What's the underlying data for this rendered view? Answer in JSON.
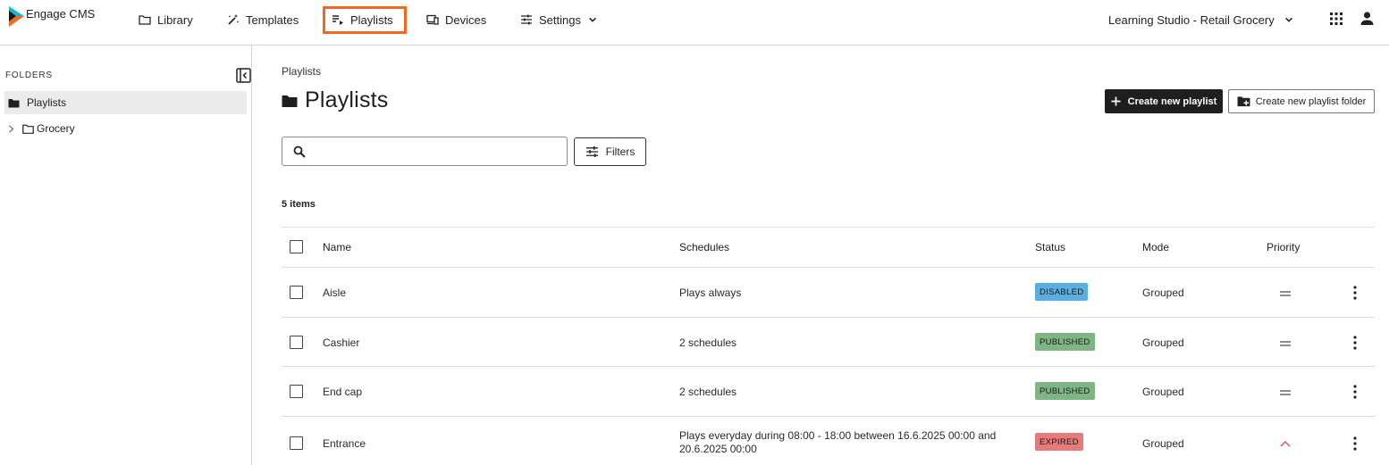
{
  "app": {
    "name": "Engage CMS"
  },
  "nav": {
    "library": "Library",
    "templates": "Templates",
    "playlists": "Playlists",
    "devices": "Devices",
    "settings": "Settings"
  },
  "org": {
    "name": "Learning Studio - Retail Grocery"
  },
  "sidebar": {
    "title": "FOLDERS",
    "folders": [
      {
        "label": "Playlists"
      },
      {
        "label": "Grocery"
      }
    ]
  },
  "main": {
    "breadcrumb": "Playlists",
    "title": "Playlists",
    "create_playlist": "Create new playlist",
    "create_folder": "Create new playlist folder",
    "search_placeholder": "",
    "filters": "Filters",
    "item_count": "5 items"
  },
  "table": {
    "headers": {
      "name": "Name",
      "schedules": "Schedules",
      "status": "Status",
      "mode": "Mode",
      "priority": "Priority"
    },
    "rows": [
      {
        "name": "Aisle",
        "schedules": "Plays always",
        "status": "DISABLED",
        "mode": "Grouped",
        "priority": "normal"
      },
      {
        "name": "Cashier",
        "schedules": "2 schedules",
        "status": "PUBLISHED",
        "mode": "Grouped",
        "priority": "normal"
      },
      {
        "name": "End cap",
        "schedules": "2 schedules",
        "status": "PUBLISHED",
        "mode": "Grouped",
        "priority": "normal"
      },
      {
        "name": "Entrance",
        "schedules": "Plays everyday during 08:00 - 18:00 between 16.6.2025 00:00 and 20.6.2025 00:00",
        "status": "EXPIRED",
        "mode": "Grouped",
        "priority": "high"
      }
    ]
  },
  "colors": {
    "accent_highlight": "#f06a1d",
    "status_disabled": "#5aaee0",
    "status_published": "#7fb584",
    "status_expired": "#e57b7b",
    "priority_high": "#d9534f",
    "brand_teal": "#1fb4c9",
    "brand_orange": "#f26a21"
  }
}
